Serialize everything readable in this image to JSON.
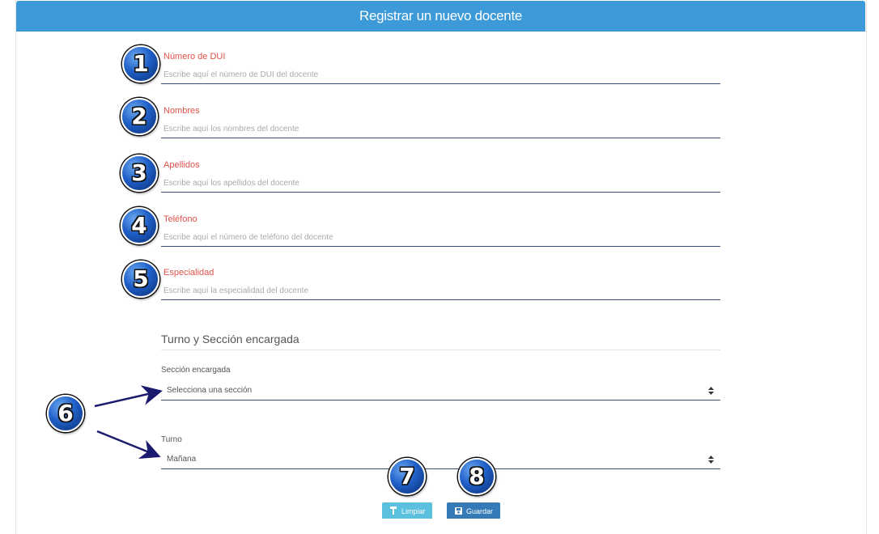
{
  "header": {
    "title": "Registrar un nuevo docente"
  },
  "fields": [
    {
      "label": "Número de DUI",
      "placeholder": "Escribe aquí el número de DUI del docente"
    },
    {
      "label": "Nombres",
      "placeholder": "Escribe aquí los nombres del docente"
    },
    {
      "label": "Apellidos",
      "placeholder": "Escribe aquí los apellidos del docente"
    },
    {
      "label": "Teléfono",
      "placeholder": "Escribe aquí el número de teléfono del docente"
    },
    {
      "label": "Especialidad",
      "placeholder": "Escribe aquí la especialidad del docente"
    }
  ],
  "section": {
    "title": "Turno y Sección encargada"
  },
  "seccion": {
    "label": "Sección encargada",
    "value": "Selecciona una sección"
  },
  "turno": {
    "label": "Turno",
    "value": "Mañana"
  },
  "buttons": {
    "limpiar": "Limpiar",
    "guardar": "Guardar"
  },
  "badges": [
    "1",
    "2",
    "3",
    "4",
    "5",
    "6",
    "7",
    "8"
  ],
  "colors": {
    "header": "#3c9ad8",
    "label": "#e0524a",
    "limpiar": "#5bc0de",
    "guardar": "#337ab7",
    "badge": "#1f5fc7"
  },
  "icons": {
    "limpiar": "paint-roller-icon",
    "guardar": "floppy-disk-icon",
    "select": "sort-caret-icon"
  }
}
